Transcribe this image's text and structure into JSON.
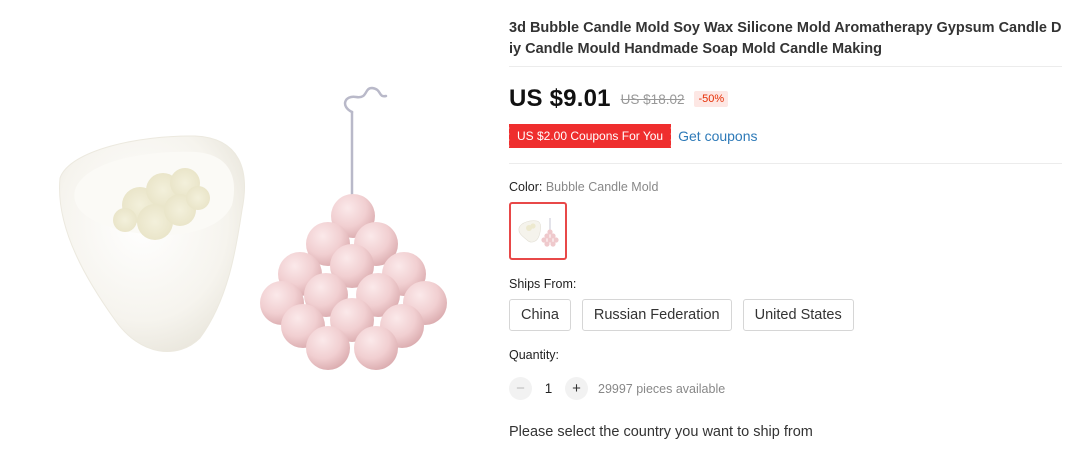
{
  "product": {
    "title": "3d Bubble Candle Mold Soy Wax Silicone Mold Aromatherapy Gypsum Candle Diy Candle Mould Handmade Soap Mold Candle Making",
    "image_alt": "Silicone bubble candle mold with pink bubble candle"
  },
  "price": {
    "current": "US $9.01",
    "original": "US $18.02",
    "discount": "-50%"
  },
  "coupon": {
    "tag": "US $2.00 Coupons For You",
    "link": "Get coupons"
  },
  "color": {
    "label": "Color:",
    "selected": "Bubble Candle Mold"
  },
  "ships_from": {
    "label": "Ships From:",
    "options": [
      "China",
      "Russian Federation",
      "United States"
    ]
  },
  "quantity": {
    "label": "Quantity:",
    "value": "1",
    "decrement": "−",
    "increment": "+",
    "available": "29997 pieces available"
  },
  "ship_note": "Please select the country you want to ship from",
  "colors": {
    "price_red": "#e62e04",
    "coupon_red": "#ef2e2e",
    "link_blue": "#2e7ab8",
    "selected_border": "#e84848"
  }
}
